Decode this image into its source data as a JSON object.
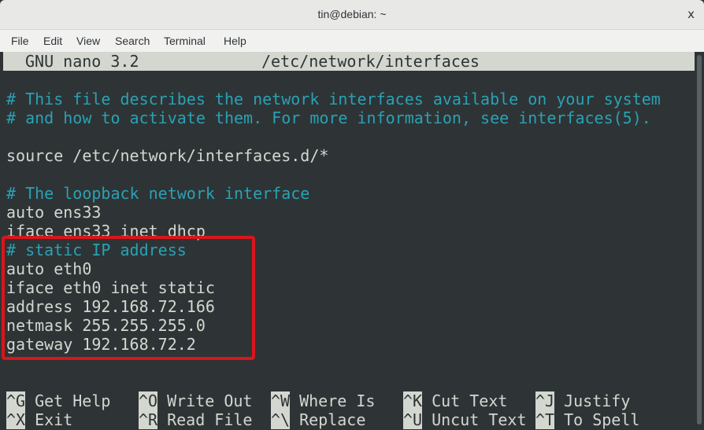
{
  "window": {
    "title": "tin@debian: ~",
    "close_label": "x"
  },
  "menu": [
    "File",
    "Edit",
    "View",
    "Search",
    "Terminal",
    "Help"
  ],
  "nano": {
    "version": "GNU nano 3.2",
    "filename": "/etc/network/interfaces"
  },
  "lines": [
    {
      "text": "# This file describes the network interfaces available on your system",
      "comment": true
    },
    {
      "text": "# and how to activate them. For more information, see interfaces(5).",
      "comment": true
    },
    {
      "text": "",
      "comment": false
    },
    {
      "text": "source /etc/network/interfaces.d/*",
      "comment": false
    },
    {
      "text": "",
      "comment": false
    },
    {
      "text": "# The loopback network interface",
      "comment": true
    },
    {
      "text": "auto ens33",
      "comment": false
    },
    {
      "text": "iface ens33 inet dhcp",
      "comment": false
    },
    {
      "text": "# static IP address",
      "comment": true
    },
    {
      "text": "auto eth0",
      "comment": false
    },
    {
      "text": "iface eth0 inet static",
      "comment": false
    },
    {
      "text": "address 192.168.72.166",
      "comment": false
    },
    {
      "text": "netmask 255.255.255.0",
      "comment": false
    },
    {
      "text": "gateway 192.168.72.2",
      "comment": false
    }
  ],
  "shortcuts": [
    [
      {
        "key": "^G",
        "label": "Get Help"
      },
      {
        "key": "^O",
        "label": "Write Out"
      },
      {
        "key": "^W",
        "label": "Where Is"
      },
      {
        "key": "^K",
        "label": "Cut Text"
      },
      {
        "key": "^J",
        "label": "Justify"
      }
    ],
    [
      {
        "key": "^X",
        "label": "Exit"
      },
      {
        "key": "^R",
        "label": "Read File"
      },
      {
        "key": "^\\",
        "label": "Replace"
      },
      {
        "key": "^U",
        "label": "Uncut Text"
      },
      {
        "key": "^T",
        "label": "To Spell"
      }
    ]
  ],
  "colors": {
    "comment": "#2aa1b3",
    "highlight_box": "#d8161b",
    "background": "#2e3436"
  }
}
